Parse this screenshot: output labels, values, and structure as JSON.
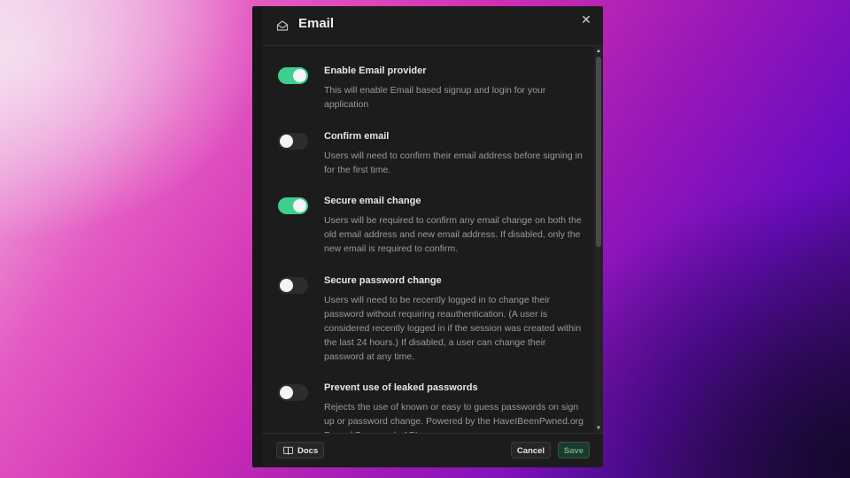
{
  "dialog": {
    "title": "Email",
    "icon": "mail-open-icon",
    "close_icon": "close-icon"
  },
  "settings": [
    {
      "label": "Enable Email provider",
      "description": "This will enable Email based signup and login for your application",
      "enabled": true
    },
    {
      "label": "Confirm email",
      "description": "Users will need to confirm their email address before signing in for the first time.",
      "enabled": false
    },
    {
      "label": "Secure email change",
      "description": "Users will be required to confirm any email change on both the old email address and new email address. If disabled, only the new email is required to confirm.",
      "enabled": true
    },
    {
      "label": "Secure password change",
      "description": "Users will need to be recently logged in to change their password without requiring reauthentication. (A user is considered recently logged in if the session was created within the last 24 hours.) If disabled, a user can change their password at any time.",
      "enabled": false
    },
    {
      "label": "Prevent use of leaked passwords",
      "description": "Rejects the use of known or easy to guess passwords on sign up or password change. Powered by the HaveIBeenPwned.org Pwned Passwords API.",
      "enabled": false
    }
  ],
  "footer": {
    "docs_label": "Docs",
    "docs_icon": "book-icon",
    "cancel_label": "Cancel",
    "save_label": "Save"
  },
  "colors": {
    "toggle_on": "#3ecf8e",
    "toggle_off": "#2d2d2d",
    "panel_bg": "#1c1c1c"
  }
}
